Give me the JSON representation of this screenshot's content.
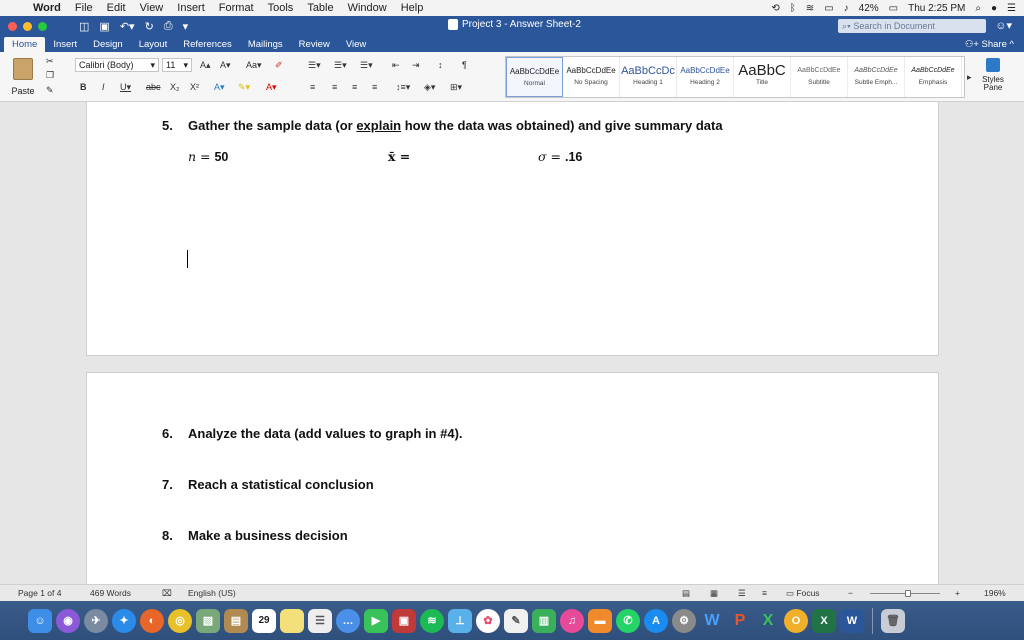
{
  "menubar": {
    "app": "Word",
    "items": [
      "File",
      "Edit",
      "View",
      "Insert",
      "Format",
      "Tools",
      "Table",
      "Window",
      "Help"
    ],
    "battery": "42%",
    "clock": "Thu 2:25 PM"
  },
  "window": {
    "title": "Project 3 - Answer Sheet-2",
    "search_placeholder": "Search in Document"
  },
  "tabs": [
    "Home",
    "Insert",
    "Design",
    "Layout",
    "References",
    "Mailings",
    "Review",
    "View"
  ],
  "share_label": "Share",
  "ribbon": {
    "paste_label": "Paste",
    "font_name": "Calibri (Body)",
    "font_size": "11",
    "styles": [
      {
        "sample": "AaBbCcDdEe",
        "name": "Normal"
      },
      {
        "sample": "AaBbCcDdEe",
        "name": "No Spacing"
      },
      {
        "sample": "AaBbCcDc",
        "name": "Heading 1"
      },
      {
        "sample": "AaBbCcDdEe",
        "name": "Heading 2"
      },
      {
        "sample": "AaBbC",
        "name": "Title"
      },
      {
        "sample": "AaBbCcDdEe",
        "name": "Subtitle"
      },
      {
        "sample": "AaBbCcDdEe",
        "name": "Subtle Emph..."
      },
      {
        "sample": "AaBbCcDdEe",
        "name": "Emphasis"
      }
    ],
    "styles_pane_label1": "Styles",
    "styles_pane_label2": "Pane"
  },
  "document": {
    "q5": {
      "num": "5.",
      "pre": "Gather the sample data (or ",
      "link": "explain",
      "post": " how the data was obtained) and give summary data"
    },
    "n_label": "n =",
    "n_value": "50",
    "xbar_label": "x̄ =",
    "sigma_label": "σ =",
    "sigma_value": ".16",
    "q6": {
      "num": "6.",
      "text": "Analyze the data (add values to graph in #4)."
    },
    "q7": {
      "num": "7.",
      "text": "Reach a statistical conclusion"
    },
    "q8": {
      "num": "8.",
      "text": "Make a business decision"
    }
  },
  "status": {
    "page": "Page 1 of 4",
    "words": "469 Words",
    "language": "English (US)",
    "focus": "Focus",
    "zoom": "196%"
  },
  "dock_apps": [
    "finder-icon",
    "siri-icon",
    "launchpad-icon",
    "safari-icon",
    "firefox-icon",
    "chrome-icon",
    "preview-icon",
    "notefile-icon",
    "calendar-icon",
    "notes-icon",
    "reminders-icon",
    "messages-icon",
    "facetime-icon",
    "photo-booth-icon",
    "spotify-icon",
    "maps-icon",
    "photos-icon",
    "textedit-icon",
    "numbers-icon",
    "itunes-icon",
    "ibooks-icon",
    "whatsapp-icon",
    "appstore-icon",
    "system-preferences-icon",
    "word-w-icon",
    "powerpoint-icon",
    "excel-x-icon",
    "onenote-icon",
    "excel-icon",
    "word-icon",
    "trash-icon"
  ],
  "calendar_day": "29"
}
